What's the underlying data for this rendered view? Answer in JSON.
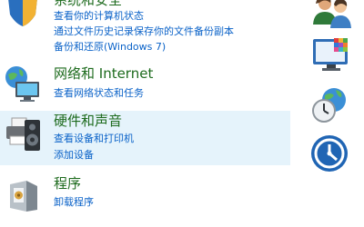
{
  "categories": [
    {
      "name": "system-security",
      "title": "系统和安全",
      "links": [
        "查看你的计算机状态",
        "通过文件历史记录保存你的文件备份副本",
        "备份和还原(Windows 7)"
      ]
    },
    {
      "name": "network-internet",
      "title": "网络和 Internet",
      "links": [
        "查看网络状态和任务"
      ]
    },
    {
      "name": "hardware-sound",
      "title": "硬件和声音",
      "links": [
        "查看设备和打印机",
        "添加设备"
      ]
    },
    {
      "name": "programs",
      "title": "程序",
      "links": [
        "卸载程序"
      ]
    }
  ],
  "icons": [
    "shield-icon",
    "network-globe-icon",
    "printer-speaker-icon",
    "programs-box-icon",
    "user-accounts-icon",
    "appearance-icon",
    "clock-globe-icon",
    "ease-of-access-icon"
  ],
  "colors": {
    "title_green": "#1e6b1e",
    "link_blue": "#0a62c8",
    "hover_bg": "#e5f3fb"
  }
}
